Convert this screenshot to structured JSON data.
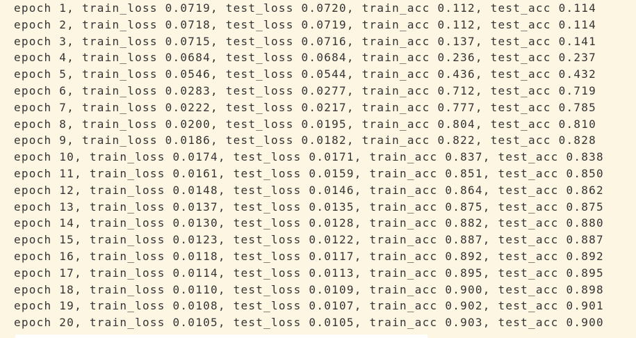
{
  "output_lines": [
    "epoch 1, train_loss 0.0719, test_loss 0.0720, train_acc 0.112, test_acc 0.114",
    "epoch 2, train_loss 0.0718, test_loss 0.0719, train_acc 0.112, test_acc 0.114",
    "epoch 3, train_loss 0.0715, test_loss 0.0716, train_acc 0.137, test_acc 0.141",
    "epoch 4, train_loss 0.0684, test_loss 0.0684, train_acc 0.236, test_acc 0.237",
    "epoch 5, train_loss 0.0546, test_loss 0.0544, train_acc 0.436, test_acc 0.432",
    "epoch 6, train_loss 0.0283, test_loss 0.0277, train_acc 0.712, test_acc 0.719",
    "epoch 7, train_loss 0.0222, test_loss 0.0217, train_acc 0.777, test_acc 0.785",
    "epoch 8, train_loss 0.0200, test_loss 0.0195, train_acc 0.804, test_acc 0.810",
    "epoch 9, train_loss 0.0186, test_loss 0.0182, train_acc 0.822, test_acc 0.828",
    "epoch 10, train_loss 0.0174, test_loss 0.0171, train_acc 0.837, test_acc 0.838",
    "epoch 11, train_loss 0.0161, test_loss 0.0159, train_acc 0.851, test_acc 0.850",
    "epoch 12, train_loss 0.0148, test_loss 0.0146, train_acc 0.864, test_acc 0.862",
    "epoch 13, train_loss 0.0137, test_loss 0.0135, train_acc 0.875, test_acc 0.875",
    "epoch 14, train_loss 0.0130, test_loss 0.0128, train_acc 0.882, test_acc 0.880",
    "epoch 15, train_loss 0.0123, test_loss 0.0122, train_acc 0.887, test_acc 0.887",
    "epoch 16, train_loss 0.0118, test_loss 0.0117, train_acc 0.892, test_acc 0.892",
    "epoch 17, train_loss 0.0114, test_loss 0.0113, train_acc 0.895, test_acc 0.895",
    "epoch 18, train_loss 0.0110, test_loss 0.0109, train_acc 0.900, test_acc 0.898",
    "epoch 19, train_loss 0.0108, test_loss 0.0107, train_acc 0.902, test_acc 0.901",
    "epoch 20, train_loss 0.0105, test_loss 0.0105, train_acc 0.903, test_acc 0.900"
  ],
  "colors": {
    "background": "#fdf6e3",
    "text": "#333333"
  }
}
